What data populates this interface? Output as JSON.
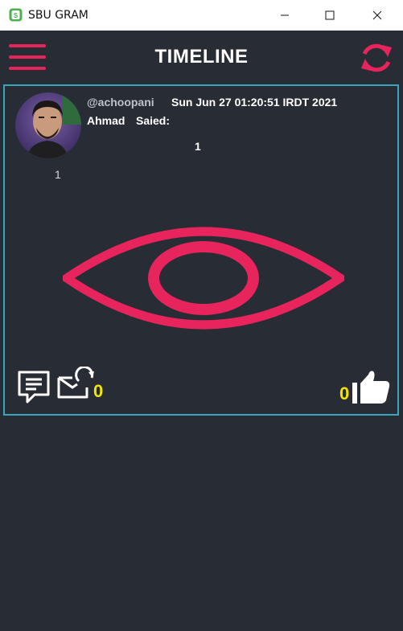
{
  "window": {
    "title": "SBU GRAM"
  },
  "header": {
    "title": "TIMELINE"
  },
  "post": {
    "username": "@achoopani",
    "date": "Sun Jun 27 01:20:51 IRDT 2021",
    "author": "Ahmad",
    "said_label": "Saied:",
    "text": "1",
    "avatar_count": "1",
    "repost_count": "0",
    "like_count": "0"
  },
  "colors": {
    "accent": "#e8245d",
    "card_border": "#3aa6b9",
    "count": "#f2e600",
    "background": "#282c34"
  },
  "icons": {
    "menu": "hamburger-menu-icon",
    "refresh": "refresh-icon",
    "comment": "comment-icon",
    "repost": "repost-icon",
    "like": "thumbs-up-icon",
    "eye": "eye-icon"
  }
}
